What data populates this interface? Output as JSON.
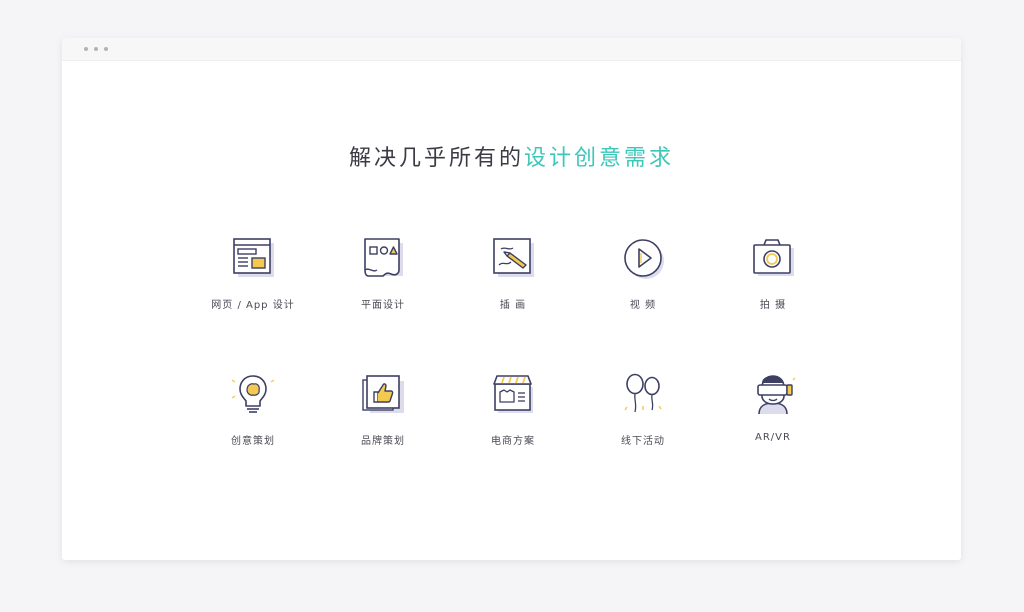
{
  "window": {
    "controls": [
      "dot",
      "dot",
      "dot"
    ]
  },
  "headline": {
    "prefix": "解决几乎所有的",
    "highlight": "设计创意需求"
  },
  "colors": {
    "accent": "#3cc7b9",
    "icon_stroke": "#3d3f63",
    "icon_highlight": "#f3c94f",
    "icon_shadow": "#dcdcec"
  },
  "services": [
    {
      "label": "网页 / App 设计",
      "icon": "webpage-icon"
    },
    {
      "label": "平面设计",
      "icon": "scroll-shapes-icon"
    },
    {
      "label": "插 画",
      "icon": "pencil-illustration-icon"
    },
    {
      "label": "视 频",
      "icon": "play-circle-icon"
    },
    {
      "label": "拍 摄",
      "icon": "camera-icon"
    },
    {
      "label": "创意策划",
      "icon": "lightbulb-brain-icon"
    },
    {
      "label": "品牌策划",
      "icon": "thumbs-up-card-icon"
    },
    {
      "label": "电商方案",
      "icon": "storefront-icon"
    },
    {
      "label": "线下活动",
      "icon": "balloons-icon"
    },
    {
      "label": "AR/VR",
      "icon": "vr-headset-icon"
    }
  ]
}
